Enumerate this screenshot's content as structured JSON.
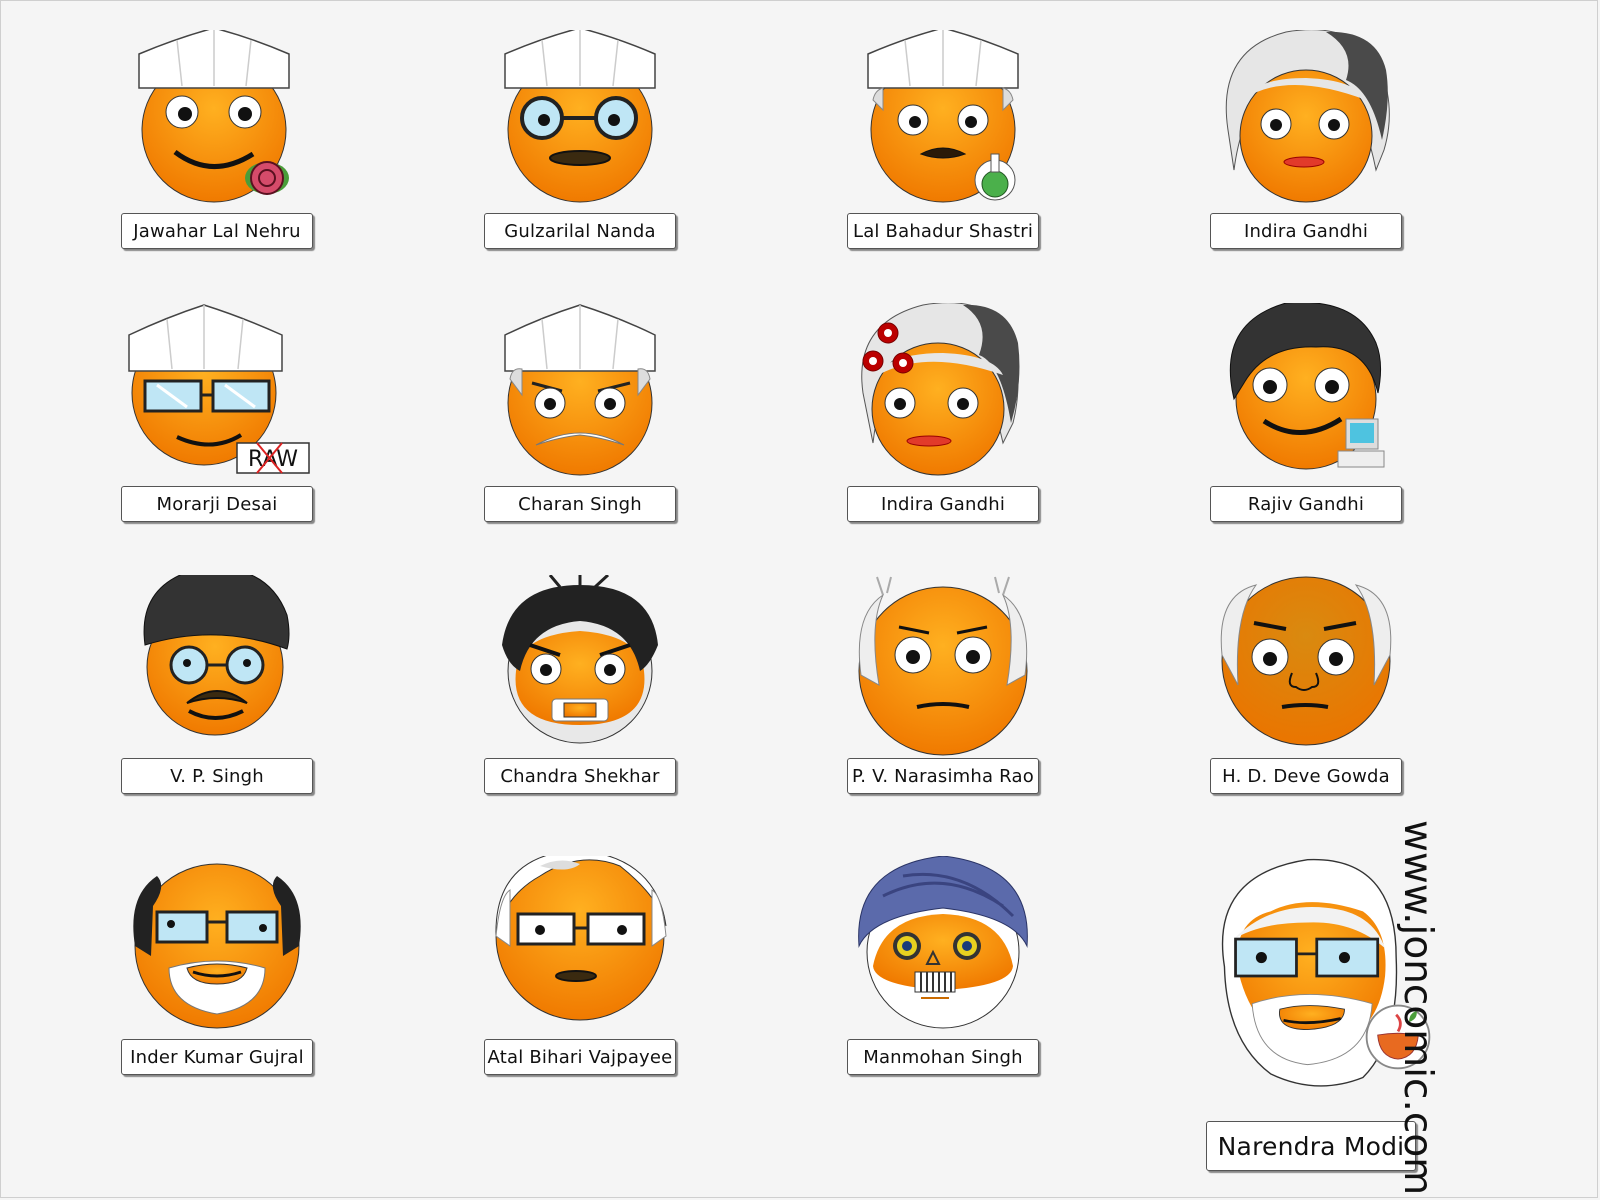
{
  "portraits": [
    {
      "name": "Jawahar Lal Nehru"
    },
    {
      "name": "Gulzarilal Nanda"
    },
    {
      "name": "Lal Bahadur Shastri"
    },
    {
      "name": "Indira Gandhi"
    },
    {
      "name": "Morarji Desai",
      "badge_text": "RAW"
    },
    {
      "name": "Charan Singh"
    },
    {
      "name": "Indira Gandhi"
    },
    {
      "name": "Rajiv Gandhi"
    },
    {
      "name": "V. P. Singh"
    },
    {
      "name": "Chandra Shekhar"
    },
    {
      "name": "P. V. Narasimha Rao"
    },
    {
      "name": "H. D. Deve Gowda"
    },
    {
      "name": "Inder Kumar Gujral"
    },
    {
      "name": "Atal Bihari Vajpayee"
    },
    {
      "name": "Manmohan Singh"
    },
    {
      "name": "Narendra Modi"
    }
  ],
  "watermark": "www.joncomic.com",
  "colors": {
    "face": "#ff9a1a",
    "face_dark": "#d9770a",
    "cap": "#ffffff",
    "turban": "#5b6aab",
    "glasses": "#bfe6f5",
    "hair_dark": "#3a3a3a",
    "hair_grey": "#e6e6e6"
  }
}
